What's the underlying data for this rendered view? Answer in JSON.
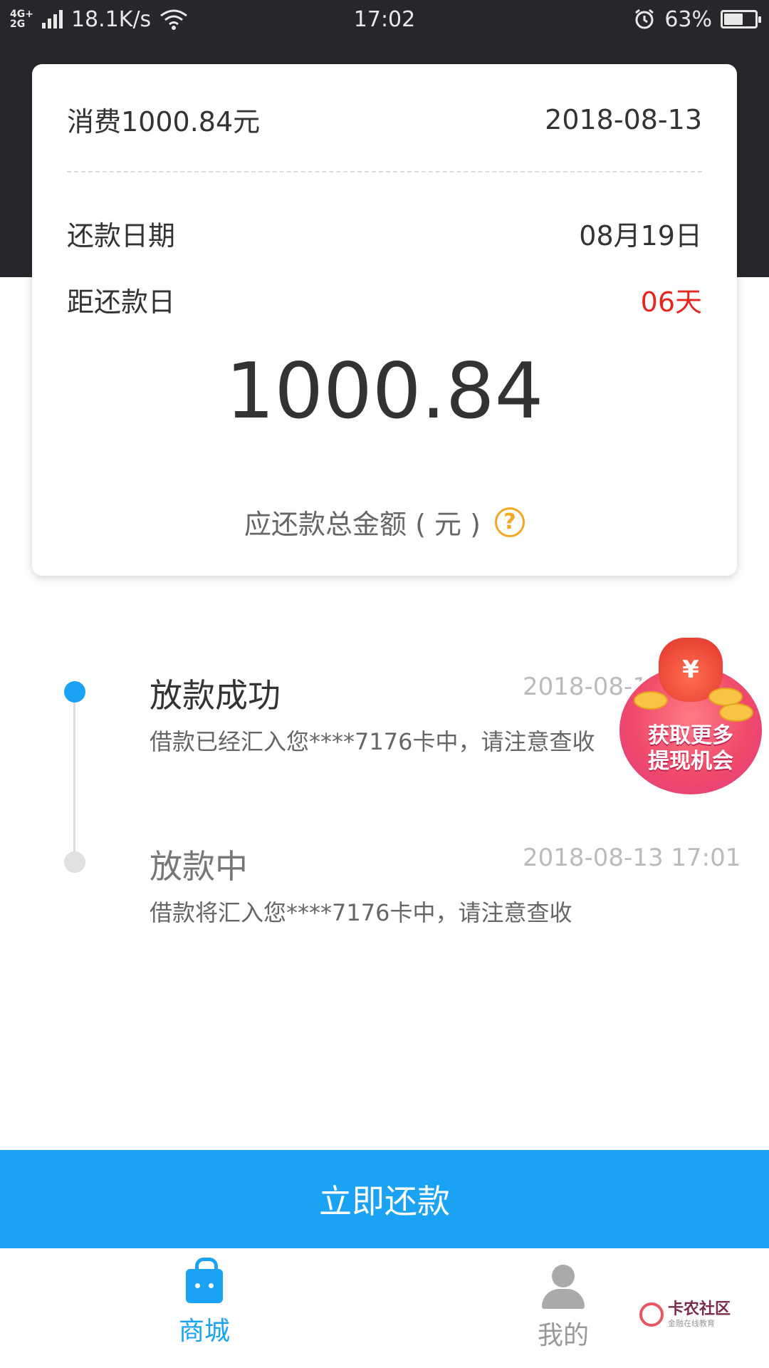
{
  "status_bar": {
    "network_top": "4G+",
    "network_bottom": "2G",
    "speed": "18.1K/s",
    "time": "17:02",
    "battery_percent": "63%",
    "battery_level": 0.63
  },
  "card": {
    "consumption_label": "消费1000.84元",
    "consumption_date": "2018-08-13",
    "repay_date_label": "还款日期",
    "repay_date_value": "08月19日",
    "days_left_label": "距还款日",
    "days_left_value": "06天",
    "total_amount": "1000.84",
    "total_amount_label": "应还款总金额 ( 元 )",
    "help_icon_glyph": "?"
  },
  "timeline": [
    {
      "title": "放款成功",
      "time": "2018-08-13 17:01",
      "time_visible": "2018-08-1",
      "desc": "借款已经汇入您****7176卡中，请注意查收",
      "status": "active"
    },
    {
      "title": "放款中",
      "time": "2018-08-13 17:01",
      "desc": "借款将汇入您****7176卡中，请注意查收",
      "status": "done"
    }
  ],
  "promo": {
    "line1": "获取更多",
    "line2": "提现机会",
    "bag_symbol": "¥"
  },
  "repay_button": {
    "label": "立即还款"
  },
  "bottom_nav": {
    "items": [
      {
        "label": "商城",
        "icon": "shopping-bag-icon",
        "active": true
      },
      {
        "label": "我的",
        "icon": "user-icon",
        "active": false
      }
    ]
  },
  "watermark": {
    "main": "卡农社区",
    "sub": "金融在线教育"
  },
  "colors": {
    "accent": "#1aa3f5",
    "header_dark": "#26272b",
    "alert_red": "#e8261f",
    "help_orange": "#f5a623"
  }
}
